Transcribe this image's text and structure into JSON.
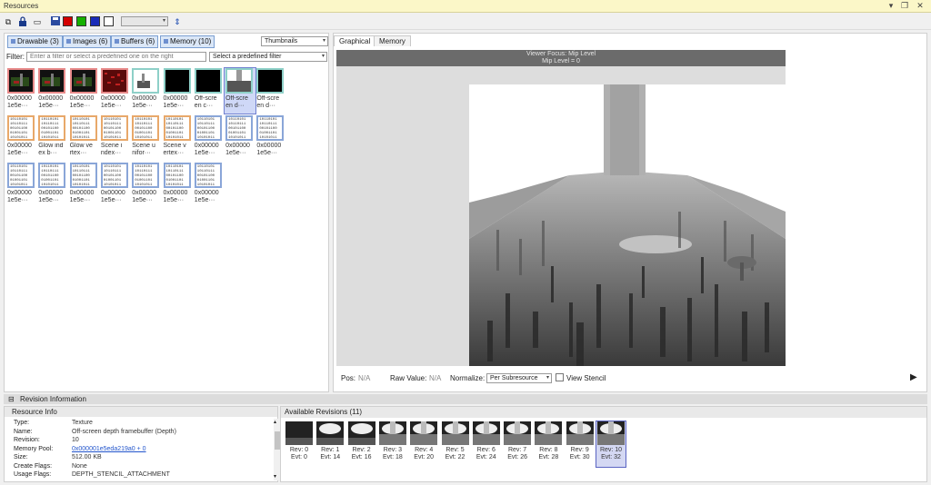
{
  "window": {
    "title": "Resources"
  },
  "toolbar": {
    "combo_value": "",
    "colors": [
      "#d40000",
      "#16b000",
      "#1a2cb8"
    ]
  },
  "filters": {
    "buttons": [
      {
        "label": "Drawable (3)"
      },
      {
        "label": "Images (6)"
      },
      {
        "label": "Buffers (6)"
      },
      {
        "label": "Memory (10)"
      }
    ],
    "view_mode": "Thumbnails",
    "filter_label": "Filter:",
    "filter_placeholder": "Enter a filter or select a predefined one on the right",
    "predefined": "Select a predefined filter"
  },
  "resources": [
    {
      "caption": "0x00000 1e5e···",
      "kind": "image-dark",
      "border": "red"
    },
    {
      "caption": "0x00000 1e5e···",
      "kind": "image-dark",
      "border": "red"
    },
    {
      "caption": "0x00000 1e5e···",
      "kind": "image-dark",
      "border": "red"
    },
    {
      "caption": "0x00000 1e5e···",
      "kind": "image-noise",
      "border": "red"
    },
    {
      "caption": "0x00000 1e5e···",
      "kind": "image-white",
      "border": "teal"
    },
    {
      "caption": "0x00000 1e5e···",
      "kind": "image-black",
      "border": "teal"
    },
    {
      "caption": "Off-scre en c···",
      "kind": "image-black",
      "border": "teal"
    },
    {
      "caption": "Off-scre en d···",
      "kind": "image-depth",
      "border": "teal",
      "selected": true
    },
    {
      "caption": "Off-scre en d···",
      "kind": "image-black",
      "border": "teal"
    },
    {
      "caption": "0x00000 1e5e···",
      "kind": "binary",
      "border": "orange"
    },
    {
      "caption": "Glow ind ex b···",
      "kind": "binary",
      "border": "orange"
    },
    {
      "caption": "Glow ve rtex···",
      "kind": "binary",
      "border": "orange"
    },
    {
      "caption": "Scene i ndex···",
      "kind": "binary",
      "border": "orange"
    },
    {
      "caption": "Scene u nifor···",
      "kind": "binary",
      "border": "orange"
    },
    {
      "caption": "Scene v ertex···",
      "kind": "binary",
      "border": "orange"
    },
    {
      "caption": "0x00000 1e5e···",
      "kind": "binary",
      "border": "blue"
    },
    {
      "caption": "0x00000 1e5e···",
      "kind": "binary",
      "border": "blue"
    },
    {
      "caption": "0x00000 1e5e···",
      "kind": "binary",
      "border": "blue"
    },
    {
      "caption": "0x00000 1e5e···",
      "kind": "binary",
      "border": "blue"
    },
    {
      "caption": "0x00000 1e5e···",
      "kind": "binary",
      "border": "blue"
    },
    {
      "caption": "0x00000 1e5e···",
      "kind": "binary",
      "border": "blue"
    },
    {
      "caption": "0x00000 1e5e···",
      "kind": "binary",
      "border": "blue"
    },
    {
      "caption": "0x00000 1e5e···",
      "kind": "binary",
      "border": "blue"
    },
    {
      "caption": "0x00000 1e5e···",
      "kind": "binary",
      "border": "blue"
    },
    {
      "caption": "0x00000 1e5e···",
      "kind": "binary",
      "border": "blue"
    }
  ],
  "binary_text": "10110101\n10110111\n00101100\n01001101\n10101011",
  "tabs": [
    {
      "label": "Graphical"
    },
    {
      "label": "Memory"
    }
  ],
  "viewer": {
    "focus_line": "Viewer Focus: Mip Level",
    "mip_line": "Mip Level = 0"
  },
  "statusbar": {
    "pos_label": "Pos:",
    "pos_value": "N/A",
    "raw_label": "Raw Value:",
    "raw_value": "N/A",
    "normalize_label": "Normalize:",
    "normalize_value": "Per Subresource",
    "stencil_label": "View Stencil"
  },
  "revision_info": {
    "title": "Revision Information"
  },
  "resource_info": {
    "title": "Resource Info",
    "rows": [
      {
        "key": "Type:",
        "value": "Texture"
      },
      {
        "key": "Name:",
        "value": "Off-screen depth framebuffer (Depth)"
      },
      {
        "key": "Revision:",
        "value": "10"
      },
      {
        "key": "Memory Pool:",
        "value": "0x000001e5eda219a0 + 0",
        "link": true
      },
      {
        "key": "Size:",
        "value": "512.00 KB"
      },
      {
        "key": "Create Flags:",
        "value": "None"
      },
      {
        "key": "Usage Flags:",
        "value": "DEPTH_STENCIL_ATTACHMENT"
      }
    ]
  },
  "available_revisions": {
    "title": "Available Revisions (11)",
    "items": [
      {
        "rev": "Rev: 0",
        "evt": "Evt: 0"
      },
      {
        "rev": "Rev: 1",
        "evt": "Evt: 14"
      },
      {
        "rev": "Rev: 2",
        "evt": "Evt: 16"
      },
      {
        "rev": "Rev: 3",
        "evt": "Evt: 18"
      },
      {
        "rev": "Rev: 4",
        "evt": "Evt: 20"
      },
      {
        "rev": "Rev: 5",
        "evt": "Evt: 22"
      },
      {
        "rev": "Rev: 6",
        "evt": "Evt: 24"
      },
      {
        "rev": "Rev: 7",
        "evt": "Evt: 26"
      },
      {
        "rev": "Rev: 8",
        "evt": "Evt: 28"
      },
      {
        "rev": "Rev: 9",
        "evt": "Evt: 30"
      },
      {
        "rev": "Rev: 10",
        "evt": "Evt: 32",
        "selected": true
      }
    ]
  }
}
